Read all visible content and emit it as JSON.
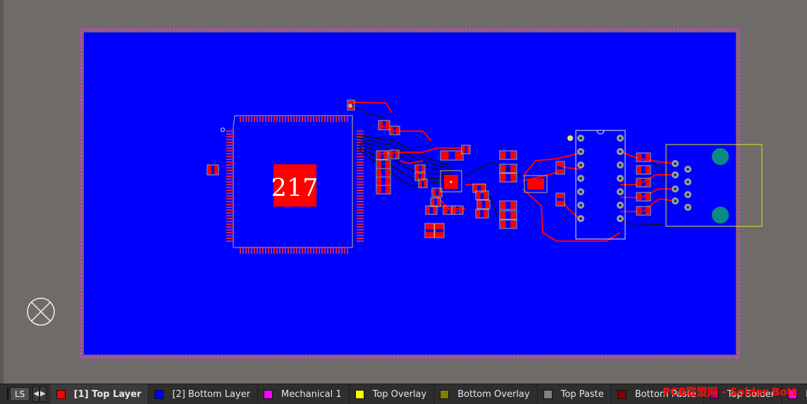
{
  "board": {
    "component_label": "217",
    "colors": {
      "workspace": "#6f6b68",
      "board_fill": "#0000ff",
      "board_outline": "#d63cd6",
      "top_copper": "#ff0000",
      "silkscreen": "#ffff00",
      "pad": "#c8a050",
      "via": "#9aa0a8",
      "bottom_trace": "#000000"
    }
  },
  "layer_bar": {
    "current_layer_color": "#ff0000",
    "ls_label": "LS",
    "prev_icon": "triangle-left",
    "next_icon": "triangle-right",
    "tabs": [
      {
        "label": "[1] Top Layer",
        "color": "#ff0000",
        "active": true
      },
      {
        "label": "[2] Bottom Layer",
        "color": "#0000ff",
        "active": false
      },
      {
        "label": "Mechanical 1",
        "color": "#ff00ff",
        "active": false
      },
      {
        "label": "Top Overlay",
        "color": "#ffff00",
        "active": false
      },
      {
        "label": "Bottom Overlay",
        "color": "#808000",
        "active": false
      },
      {
        "label": "Top Paste",
        "color": "#808080",
        "active": false
      },
      {
        "label": "Bottom Paste",
        "color": "#800000",
        "active": false
      },
      {
        "label": "Top Solder",
        "color": "#800080",
        "active": false
      },
      {
        "label": "Bott",
        "color": "#ff00ff",
        "active": false
      }
    ],
    "watermark": "PCB联盟网 - Solder Bott"
  }
}
